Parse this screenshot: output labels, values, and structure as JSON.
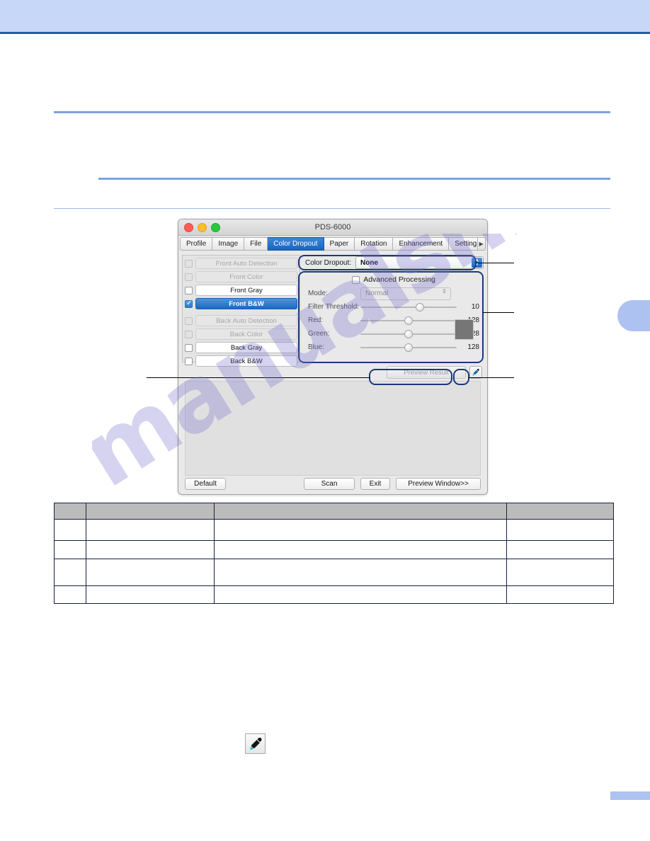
{
  "page": {
    "header_band_color": "#c7d7f7",
    "header_rule_color": "#1f5fa9",
    "watermark_text": "manualshive.com"
  },
  "scanner_dialog": {
    "window_title": "PDS-6000",
    "traffic_lights": {
      "close": "close-button",
      "minimize": "minimize-button",
      "zoom": "zoom-button"
    },
    "tabs": [
      {
        "label": "Profile",
        "active": false
      },
      {
        "label": "Image",
        "active": false
      },
      {
        "label": "File",
        "active": false
      },
      {
        "label": "Color Dropout",
        "active": true
      },
      {
        "label": "Paper",
        "active": false
      },
      {
        "label": "Rotation",
        "active": false
      },
      {
        "label": "Enhancement",
        "active": false
      },
      {
        "label": "Setting",
        "active": false
      }
    ],
    "tab_scroll_right_icon": "chevron-right-icon",
    "source_list": [
      {
        "label": "Front Auto Detection",
        "checked": false,
        "disabled": true,
        "selected": false
      },
      {
        "label": "Front Color",
        "checked": false,
        "disabled": true,
        "selected": false
      },
      {
        "label": "Front Gray",
        "checked": false,
        "disabled": false,
        "selected": false
      },
      {
        "label": "Front B&W",
        "checked": true,
        "disabled": false,
        "selected": true
      },
      {
        "label": "Back Auto Detection",
        "checked": false,
        "disabled": true,
        "selected": false
      },
      {
        "label": "Back Color",
        "checked": false,
        "disabled": true,
        "selected": false
      },
      {
        "label": "Back Gray",
        "checked": false,
        "disabled": false,
        "selected": false
      },
      {
        "label": "Back B&W",
        "checked": false,
        "disabled": false,
        "selected": false
      }
    ],
    "color_dropout": {
      "label": "Color Dropout:",
      "value": "None",
      "stepper_icon": "stepper-updown-icon"
    },
    "advanced_processing": {
      "label": "Advanced Processing",
      "checked": false,
      "mode": {
        "label": "Mode:",
        "value": "Normal",
        "disabled": true,
        "stepper_icon": "stepper-updown-icon"
      },
      "sliders": [
        {
          "label": "Filter Threshold:",
          "value": "10",
          "percent": 62
        },
        {
          "label": "Red:",
          "value": "128",
          "percent": 50
        },
        {
          "label": "Green:",
          "value": "128",
          "percent": 50
        },
        {
          "label": "Blue:",
          "value": "128",
          "percent": 50
        }
      ],
      "swatch_color": "#767676"
    },
    "preview_result_button": "Preview Result",
    "picker_button_icon": "eyedropper-icon",
    "bottom_buttons": {
      "default": "Default",
      "scan": "Scan",
      "exit": "Exit",
      "preview_window": "Preview Window>>"
    }
  },
  "info_table": {
    "columns": [
      "",
      "",
      "",
      ""
    ],
    "rows": [
      [
        "",
        "",
        "",
        ""
      ],
      [
        "",
        "",
        "",
        ""
      ],
      [
        "",
        "",
        "",
        ""
      ],
      [
        "",
        "",
        "",
        ""
      ]
    ]
  },
  "figure": {
    "eyedropper_icon": "eyedropper-icon"
  }
}
